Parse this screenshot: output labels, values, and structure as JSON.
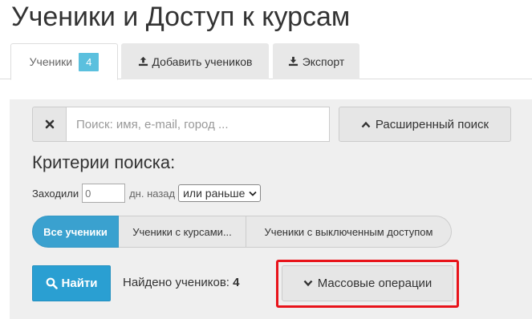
{
  "page": {
    "title": "Ученики и Доступ к курсам"
  },
  "tabs": [
    {
      "label": "Ученики",
      "badge": "4",
      "active": true
    },
    {
      "label": "Добавить учеников",
      "icon": "upload-icon"
    },
    {
      "label": "Экспорт",
      "icon": "download-icon"
    }
  ],
  "search": {
    "clear_icon": "close-icon",
    "placeholder": "Поиск: имя, e-mail, город ...",
    "value": "",
    "advanced_label": "Расширенный поиск",
    "advanced_icon": "chevron-up-icon"
  },
  "criteria": {
    "title": "Критерии поиска:",
    "visited_label": "Заходили",
    "days_placeholder": "0",
    "days_unit": "дн. назад",
    "period_select": "или раньше"
  },
  "segments": [
    "Все ученики",
    "Ученики с курсами...",
    "Ученики с выключенным доступом"
  ],
  "actions": {
    "find_label": "Найти",
    "find_icon": "search-icon",
    "found_label": "Найдено учеников:",
    "found_count": "4",
    "mass_label": "Массовые операции",
    "mass_icon": "chevron-down-icon"
  },
  "colors": {
    "accent": "#2a9fd2",
    "badge": "#5bc0de",
    "highlight": "#e8131a",
    "panel_bg": "#efefef"
  }
}
